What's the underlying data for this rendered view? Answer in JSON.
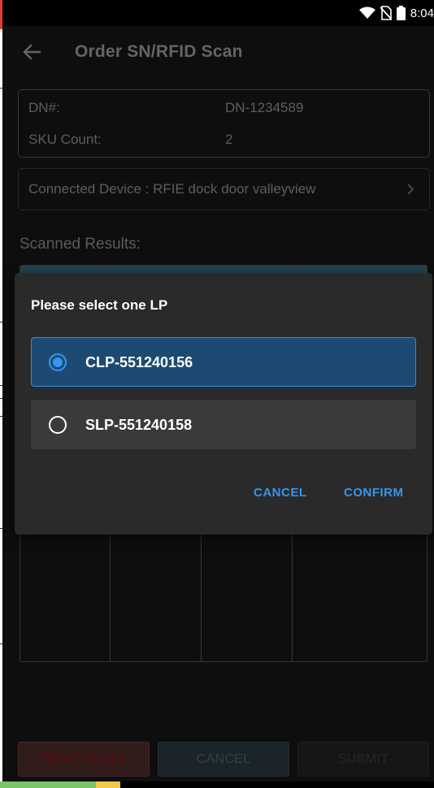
{
  "status_bar": {
    "time": "8:04",
    "icons": [
      "wifi-icon",
      "no-sim-icon",
      "battery-icon"
    ]
  },
  "toolbar": {
    "title": "Order SN/RFID Scan",
    "back_icon": "arrow-left-icon"
  },
  "order": {
    "dn_label": "DN#:",
    "dn_value": "DN-1234589",
    "sku_label": "SKU Count:",
    "sku_value": "2"
  },
  "device": {
    "text": "Connected Device : RFIE dock door valleyview",
    "icon": "chevron-right-icon"
  },
  "scanned_results_label": "Scanned Results:",
  "dialog": {
    "title": "Please select one LP",
    "options": [
      {
        "label": "CLP-551240156",
        "selected": true
      },
      {
        "label": "SLP-551240158",
        "selected": false
      }
    ],
    "cancel_label": "CANCEL",
    "confirm_label": "CONFIRM"
  },
  "footer": {
    "remove_all_label": "REMOVE ALL",
    "cancel_label": "CANCEL",
    "submit_label": "SUBMIT"
  },
  "colors": {
    "accent": "#3596ee",
    "background": "#161616",
    "dialog": "#2a2a2a"
  }
}
